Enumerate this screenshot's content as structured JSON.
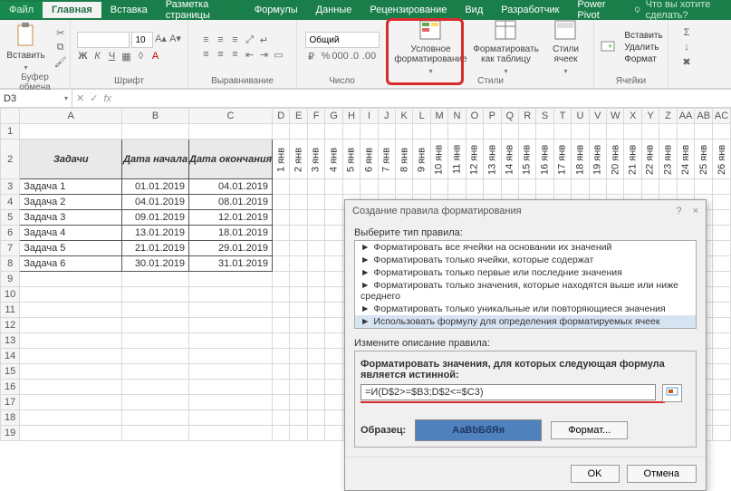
{
  "tabs": {
    "file": "Файл",
    "items": [
      "Главная",
      "Вставка",
      "Разметка страницы",
      "Формулы",
      "Данные",
      "Рецензирование",
      "Вид",
      "Разработчик",
      "Power Pivot"
    ],
    "active_index": 0,
    "tell_me": "Что вы хотите сделать?"
  },
  "ribbon": {
    "clipboard": {
      "paste": "Вставить",
      "group": "Буфер обмена"
    },
    "font": {
      "size": "10",
      "group": "Шрифт"
    },
    "alignment": {
      "group": "Выравнивание"
    },
    "number": {
      "format": "Общий",
      "group": "Число"
    },
    "styles": {
      "cond": "Условное форматирование",
      "table": "Форматировать как таблицу",
      "cell": "Стили ячеек",
      "group": "Стили"
    },
    "cells": {
      "insert": "Вставить",
      "delete": "Удалить",
      "format": "Формат",
      "group": "Ячейки"
    }
  },
  "namebox": "D3",
  "columns": [
    "A",
    "B",
    "C",
    "D",
    "E",
    "F",
    "G",
    "H",
    "I",
    "J",
    "K",
    "L",
    "M",
    "N",
    "O",
    "P",
    "Q",
    "R",
    "S",
    "T",
    "U",
    "V",
    "W",
    "X",
    "Y",
    "Z",
    "AA",
    "AB",
    "AC"
  ],
  "headers": {
    "task": "Задачи",
    "start": "Дата начала",
    "end": "Дата окончания"
  },
  "dates": [
    "1 янв",
    "2 янв",
    "3 янв",
    "4 янв",
    "5 янв",
    "6 янв",
    "7 янв",
    "8 янв",
    "9 янв",
    "10 янв",
    "11 янв",
    "12 янв",
    "13 янв",
    "14 янв",
    "15 янв",
    "16 янв",
    "17 янв",
    "18 янв",
    "19 янв",
    "20 янв",
    "21 янв",
    "22 янв",
    "23 янв",
    "24 янв",
    "25 янв",
    "26 янв"
  ],
  "rows": [
    {
      "task": "Задача 1",
      "start": "01.01.2019",
      "end": "04.01.2019"
    },
    {
      "task": "Задача 2",
      "start": "04.01.2019",
      "end": "08.01.2019"
    },
    {
      "task": "Задача 3",
      "start": "09.01.2019",
      "end": "12.01.2019"
    },
    {
      "task": "Задача 4",
      "start": "13.01.2019",
      "end": "18.01.2019"
    },
    {
      "task": "Задача 5",
      "start": "21.01.2019",
      "end": "29.01.2019"
    },
    {
      "task": "Задача 6",
      "start": "30.01.2019",
      "end": "31.01.2019"
    }
  ],
  "dlg": {
    "title": "Создание правила форматирования",
    "help": "?",
    "close": "×",
    "pick_label": "Выберите тип правила:",
    "rules": [
      "Форматировать все ячейки на основании их значений",
      "Форматировать только ячейки, которые содержат",
      "Форматировать только первые или последние значения",
      "Форматировать только значения, которые находятся выше или ниже среднего",
      "Форматировать только уникальные или повторяющиеся значения",
      "Использовать формулу для определения форматируемых ячеек"
    ],
    "selected_rule_index": 5,
    "edit_label": "Измените описание правила:",
    "formula_label": "Форматировать значения, для которых следующая формула является истинной:",
    "formula": "=И(D$2>=$B3;D$2<=$C3)",
    "preview_label": "Образец:",
    "preview_text": "АаBbБбЯя",
    "format_btn": "Формат...",
    "ok": "OK",
    "cancel": "Отмена"
  }
}
